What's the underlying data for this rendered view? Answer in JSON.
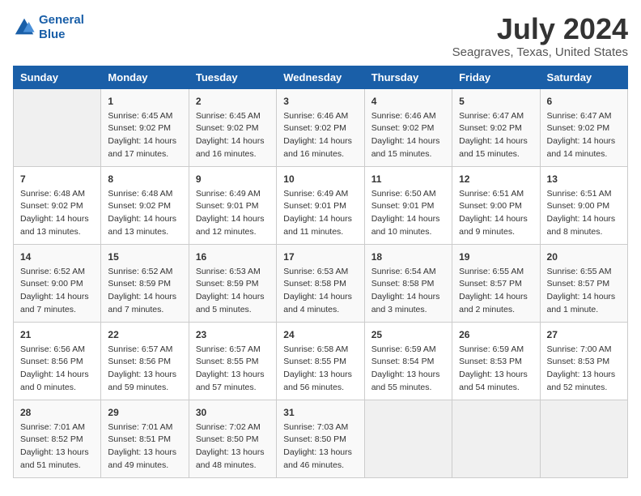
{
  "header": {
    "logo_line1": "General",
    "logo_line2": "Blue",
    "month": "July 2024",
    "location": "Seagraves, Texas, United States"
  },
  "days_of_week": [
    "Sunday",
    "Monday",
    "Tuesday",
    "Wednesday",
    "Thursday",
    "Friday",
    "Saturday"
  ],
  "weeks": [
    [
      {
        "day": "",
        "info": ""
      },
      {
        "day": "1",
        "info": "Sunrise: 6:45 AM\nSunset: 9:02 PM\nDaylight: 14 hours\nand 17 minutes."
      },
      {
        "day": "2",
        "info": "Sunrise: 6:45 AM\nSunset: 9:02 PM\nDaylight: 14 hours\nand 16 minutes."
      },
      {
        "day": "3",
        "info": "Sunrise: 6:46 AM\nSunset: 9:02 PM\nDaylight: 14 hours\nand 16 minutes."
      },
      {
        "day": "4",
        "info": "Sunrise: 6:46 AM\nSunset: 9:02 PM\nDaylight: 14 hours\nand 15 minutes."
      },
      {
        "day": "5",
        "info": "Sunrise: 6:47 AM\nSunset: 9:02 PM\nDaylight: 14 hours\nand 15 minutes."
      },
      {
        "day": "6",
        "info": "Sunrise: 6:47 AM\nSunset: 9:02 PM\nDaylight: 14 hours\nand 14 minutes."
      }
    ],
    [
      {
        "day": "7",
        "info": "Sunrise: 6:48 AM\nSunset: 9:02 PM\nDaylight: 14 hours\nand 13 minutes."
      },
      {
        "day": "8",
        "info": "Sunrise: 6:48 AM\nSunset: 9:02 PM\nDaylight: 14 hours\nand 13 minutes."
      },
      {
        "day": "9",
        "info": "Sunrise: 6:49 AM\nSunset: 9:01 PM\nDaylight: 14 hours\nand 12 minutes."
      },
      {
        "day": "10",
        "info": "Sunrise: 6:49 AM\nSunset: 9:01 PM\nDaylight: 14 hours\nand 11 minutes."
      },
      {
        "day": "11",
        "info": "Sunrise: 6:50 AM\nSunset: 9:01 PM\nDaylight: 14 hours\nand 10 minutes."
      },
      {
        "day": "12",
        "info": "Sunrise: 6:51 AM\nSunset: 9:00 PM\nDaylight: 14 hours\nand 9 minutes."
      },
      {
        "day": "13",
        "info": "Sunrise: 6:51 AM\nSunset: 9:00 PM\nDaylight: 14 hours\nand 8 minutes."
      }
    ],
    [
      {
        "day": "14",
        "info": "Sunrise: 6:52 AM\nSunset: 9:00 PM\nDaylight: 14 hours\nand 7 minutes."
      },
      {
        "day": "15",
        "info": "Sunrise: 6:52 AM\nSunset: 8:59 PM\nDaylight: 14 hours\nand 7 minutes."
      },
      {
        "day": "16",
        "info": "Sunrise: 6:53 AM\nSunset: 8:59 PM\nDaylight: 14 hours\nand 5 minutes."
      },
      {
        "day": "17",
        "info": "Sunrise: 6:53 AM\nSunset: 8:58 PM\nDaylight: 14 hours\nand 4 minutes."
      },
      {
        "day": "18",
        "info": "Sunrise: 6:54 AM\nSunset: 8:58 PM\nDaylight: 14 hours\nand 3 minutes."
      },
      {
        "day": "19",
        "info": "Sunrise: 6:55 AM\nSunset: 8:57 PM\nDaylight: 14 hours\nand 2 minutes."
      },
      {
        "day": "20",
        "info": "Sunrise: 6:55 AM\nSunset: 8:57 PM\nDaylight: 14 hours\nand 1 minute."
      }
    ],
    [
      {
        "day": "21",
        "info": "Sunrise: 6:56 AM\nSunset: 8:56 PM\nDaylight: 14 hours\nand 0 minutes."
      },
      {
        "day": "22",
        "info": "Sunrise: 6:57 AM\nSunset: 8:56 PM\nDaylight: 13 hours\nand 59 minutes."
      },
      {
        "day": "23",
        "info": "Sunrise: 6:57 AM\nSunset: 8:55 PM\nDaylight: 13 hours\nand 57 minutes."
      },
      {
        "day": "24",
        "info": "Sunrise: 6:58 AM\nSunset: 8:55 PM\nDaylight: 13 hours\nand 56 minutes."
      },
      {
        "day": "25",
        "info": "Sunrise: 6:59 AM\nSunset: 8:54 PM\nDaylight: 13 hours\nand 55 minutes."
      },
      {
        "day": "26",
        "info": "Sunrise: 6:59 AM\nSunset: 8:53 PM\nDaylight: 13 hours\nand 54 minutes."
      },
      {
        "day": "27",
        "info": "Sunrise: 7:00 AM\nSunset: 8:53 PM\nDaylight: 13 hours\nand 52 minutes."
      }
    ],
    [
      {
        "day": "28",
        "info": "Sunrise: 7:01 AM\nSunset: 8:52 PM\nDaylight: 13 hours\nand 51 minutes."
      },
      {
        "day": "29",
        "info": "Sunrise: 7:01 AM\nSunset: 8:51 PM\nDaylight: 13 hours\nand 49 minutes."
      },
      {
        "day": "30",
        "info": "Sunrise: 7:02 AM\nSunset: 8:50 PM\nDaylight: 13 hours\nand 48 minutes."
      },
      {
        "day": "31",
        "info": "Sunrise: 7:03 AM\nSunset: 8:50 PM\nDaylight: 13 hours\nand 46 minutes."
      },
      {
        "day": "",
        "info": ""
      },
      {
        "day": "",
        "info": ""
      },
      {
        "day": "",
        "info": ""
      }
    ]
  ]
}
